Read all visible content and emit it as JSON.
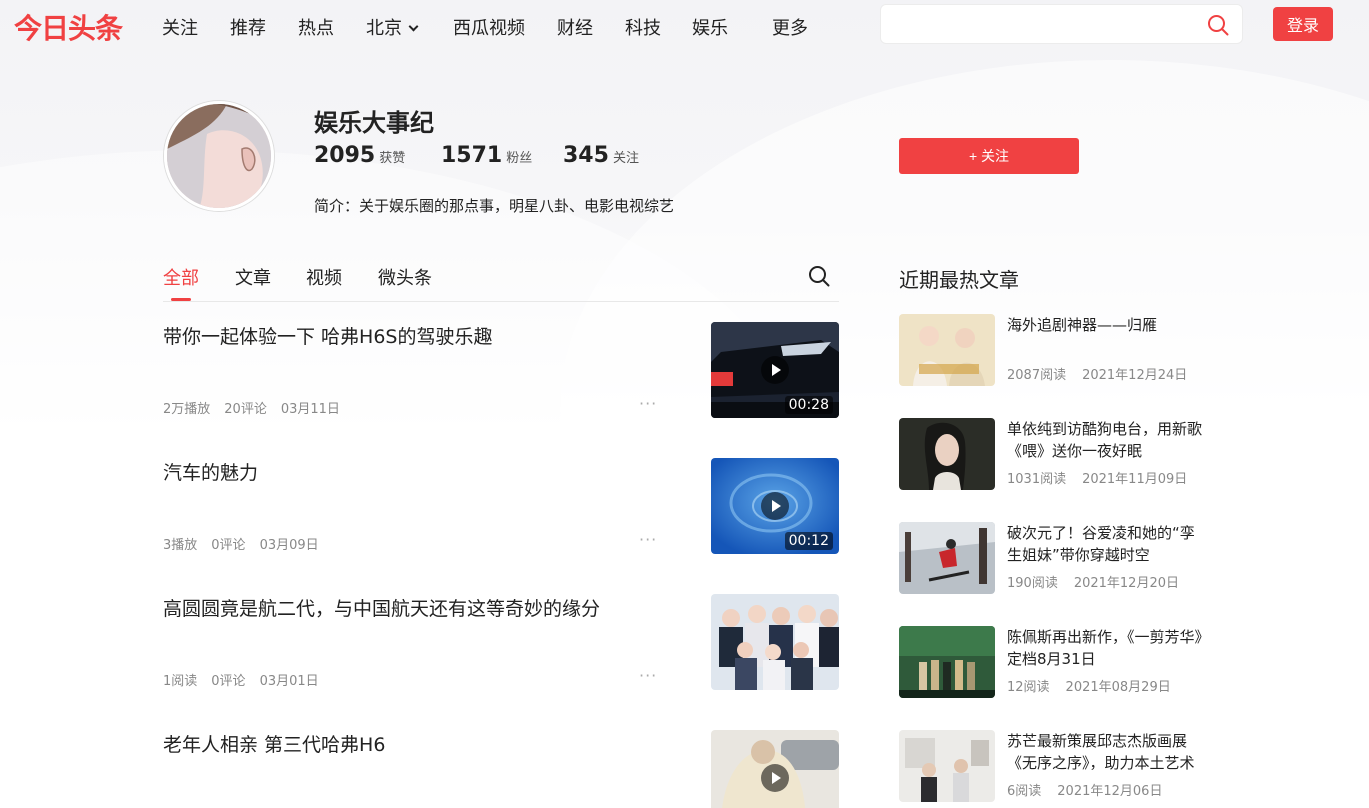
{
  "brand": {
    "logo": "今日头条",
    "accent": "#f04142"
  },
  "nav": {
    "items": [
      "关注",
      "推荐",
      "热点",
      "北京",
      "西瓜视频",
      "财经",
      "科技",
      "娱乐",
      "更多"
    ],
    "search_placeholder": "",
    "login_label": "登录"
  },
  "profile": {
    "name": "娱乐大事纪",
    "likes_value": "2095",
    "likes_label": "获赞",
    "fans_value": "1571",
    "fans_label": "粉丝",
    "following_value": "345",
    "following_label": "关注",
    "intro": "简介：关于娱乐圈的那点事，明星八卦、电影电视综艺",
    "follow_label": "+ 关注"
  },
  "tabs": [
    "全部",
    "文章",
    "视频",
    "微头条"
  ],
  "feed": [
    {
      "title": "带你一起体验一下 哈弗H6S的驾驶乐趣",
      "views": "2万播放",
      "comments": "20评论",
      "date": "03月11日",
      "duration": "00:28",
      "has_video": true
    },
    {
      "title": "汽车的魅力",
      "views": "3播放",
      "comments": "0评论",
      "date": "03月09日",
      "duration": "00:12",
      "has_video": true
    },
    {
      "title": "高圆圆竟是航二代，与中国航天还有这等奇妙的缘分",
      "views": "1阅读",
      "comments": "0评论",
      "date": "03月01日",
      "duration": "",
      "has_video": false
    },
    {
      "title": "老年人相亲 第三代哈弗H6",
      "views": "",
      "comments": "",
      "date": "",
      "duration": "",
      "has_video": true
    }
  ],
  "sidebar": {
    "title": "近期最热文章",
    "items": [
      {
        "title": "海外追剧神器——归雁",
        "reads": "2087阅读",
        "date": "2021年12月24日"
      },
      {
        "title": "单依纯到访酷狗电台，用新歌《喂》送你一夜好眠",
        "reads": "1031阅读",
        "date": "2021年11月09日"
      },
      {
        "title": "破次元了！谷爱凌和她的“孪生姐妹”带你穿越时空",
        "reads": "190阅读",
        "date": "2021年12月20日"
      },
      {
        "title": "陈佩斯再出新作，《一剪芳华》定档8月31日",
        "reads": "12阅读",
        "date": "2021年08月29日"
      },
      {
        "title": "苏芒最新策展邱志杰版画展《无序之序》，助力本土艺术",
        "reads": "6阅读",
        "date": "2021年12月06日"
      }
    ]
  }
}
